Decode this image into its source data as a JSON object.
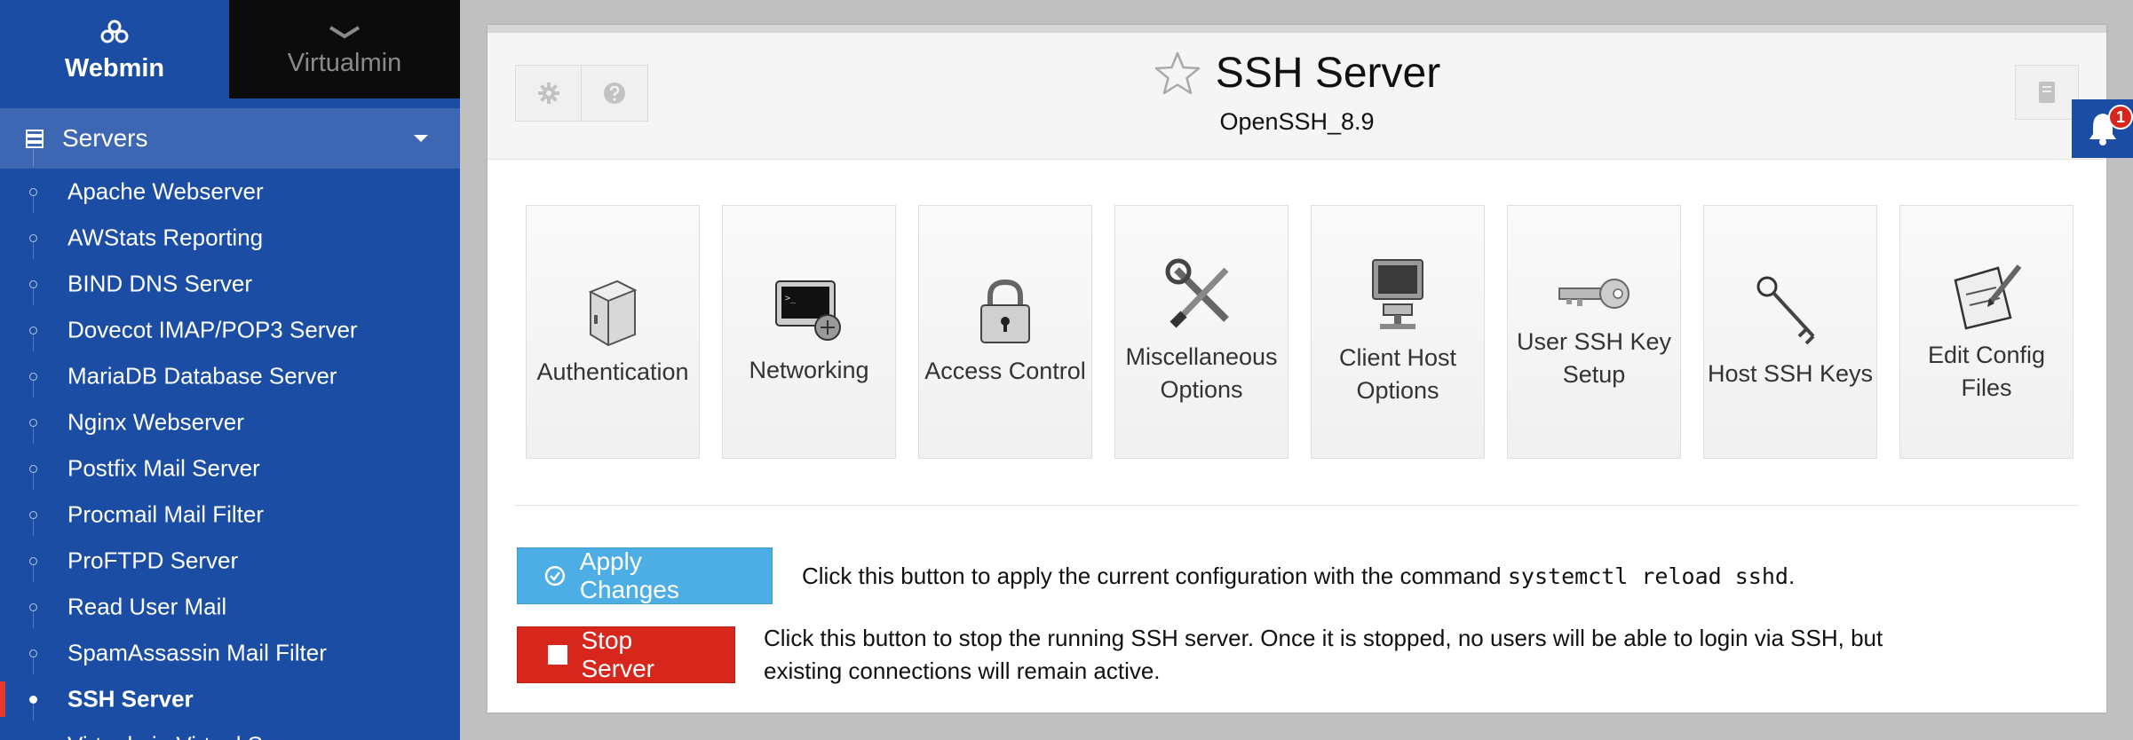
{
  "sidebar": {
    "webmin_label": "Webmin",
    "virtualmin_label": "Virtualmin",
    "section_label": "Servers",
    "items": [
      {
        "label": "Apache Webserver"
      },
      {
        "label": "AWStats Reporting"
      },
      {
        "label": "BIND DNS Server"
      },
      {
        "label": "Dovecot IMAP/POP3 Server"
      },
      {
        "label": "MariaDB Database Server"
      },
      {
        "label": "Nginx Webserver"
      },
      {
        "label": "Postfix Mail Server"
      },
      {
        "label": "Procmail Mail Filter"
      },
      {
        "label": "ProFTPD Server"
      },
      {
        "label": "Read User Mail"
      },
      {
        "label": "SpamAssassin Mail Filter"
      },
      {
        "label": "SSH Server",
        "active": true
      },
      {
        "label": "Virtualmin Virtual Se"
      }
    ]
  },
  "header": {
    "title": "SSH Server",
    "subtitle": "OpenSSH_8.9"
  },
  "tiles": [
    {
      "label": "Authentication",
      "icon": "safe-icon"
    },
    {
      "label": "Networking",
      "icon": "network-terminal-icon"
    },
    {
      "label": "Access Control",
      "icon": "padlock-icon"
    },
    {
      "label": "Miscellaneous Options",
      "icon": "tools-icon"
    },
    {
      "label": "Client Host Options",
      "icon": "computer-icon"
    },
    {
      "label": "User SSH Key Setup",
      "icon": "key-icon"
    },
    {
      "label": "Host SSH Keys",
      "icon": "skeleton-key-icon"
    },
    {
      "label": "Edit Config Files",
      "icon": "clipboard-edit-icon"
    }
  ],
  "actions": {
    "apply_label": "Apply Changes",
    "apply_desc_before": "Click this button to apply the current configuration with the command ",
    "apply_command": "systemctl reload sshd",
    "apply_desc_after": ".",
    "stop_label": "Stop Server",
    "stop_desc": "Click this button to stop the running SSH server. Once it is stopped, no users will be able to login via SSH, but existing connections will remain active."
  },
  "notifications": {
    "count": "1"
  },
  "colors": {
    "sidebar": "#1a4da3",
    "apply": "#4daee5",
    "stop": "#d7271c",
    "active_marker": "#e43a33"
  }
}
